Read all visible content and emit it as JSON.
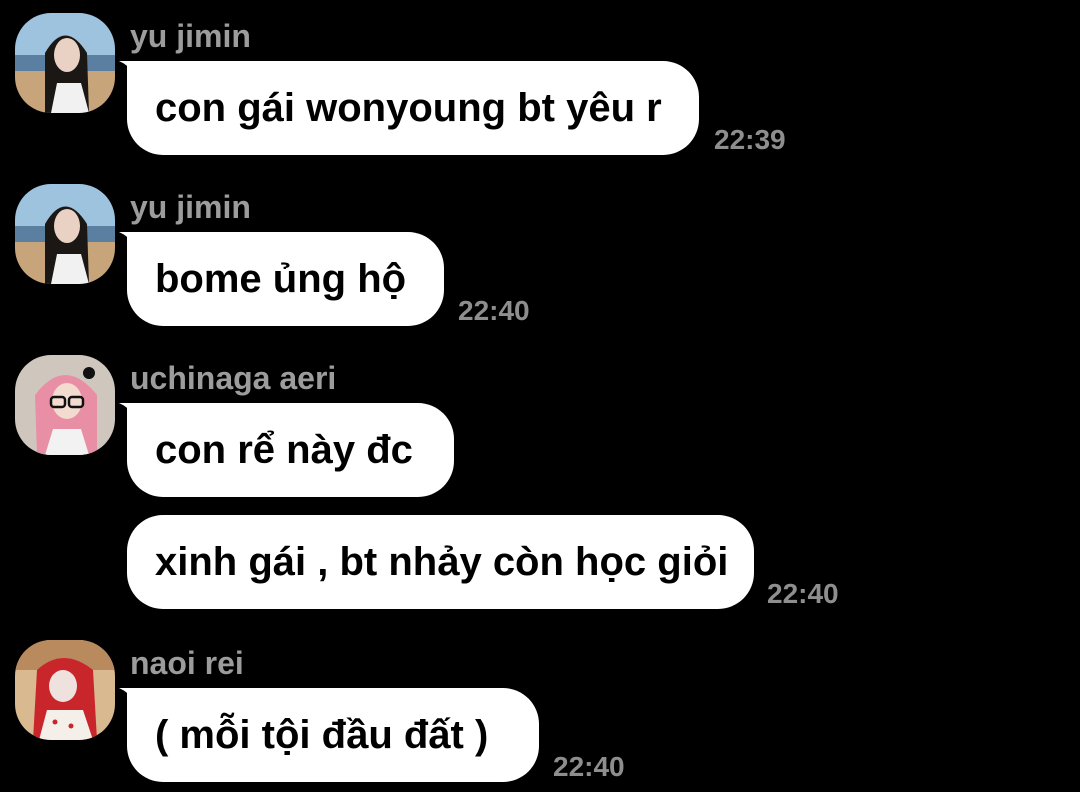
{
  "colors": {
    "background": "#000000",
    "bubble": "#ffffff",
    "sender_name": "#9c9c9c",
    "timestamp": "#8e8e8e"
  },
  "messages": [
    {
      "sender": "yu jimin",
      "avatar_icon": "user-avatar-photo",
      "bubbles": [
        {
          "text": "con gái wonyoung bt yêu r",
          "time": "22:39"
        }
      ]
    },
    {
      "sender": "yu jimin",
      "avatar_icon": "user-avatar-photo",
      "bubbles": [
        {
          "text": "bome ủng hộ",
          "time": "22:40"
        }
      ]
    },
    {
      "sender": "uchinaga aeri",
      "avatar_icon": "user-avatar-photo",
      "bubbles": [
        {
          "text": "con rể này đc",
          "time": ""
        },
        {
          "text": "xinh gái , bt nhảy còn học giỏi",
          "time": "22:40"
        }
      ]
    },
    {
      "sender": "naoi rei",
      "avatar_icon": "user-avatar-photo",
      "bubbles": [
        {
          "text": "( mỗi tội đầu đất )",
          "time": "22:40"
        }
      ]
    }
  ]
}
